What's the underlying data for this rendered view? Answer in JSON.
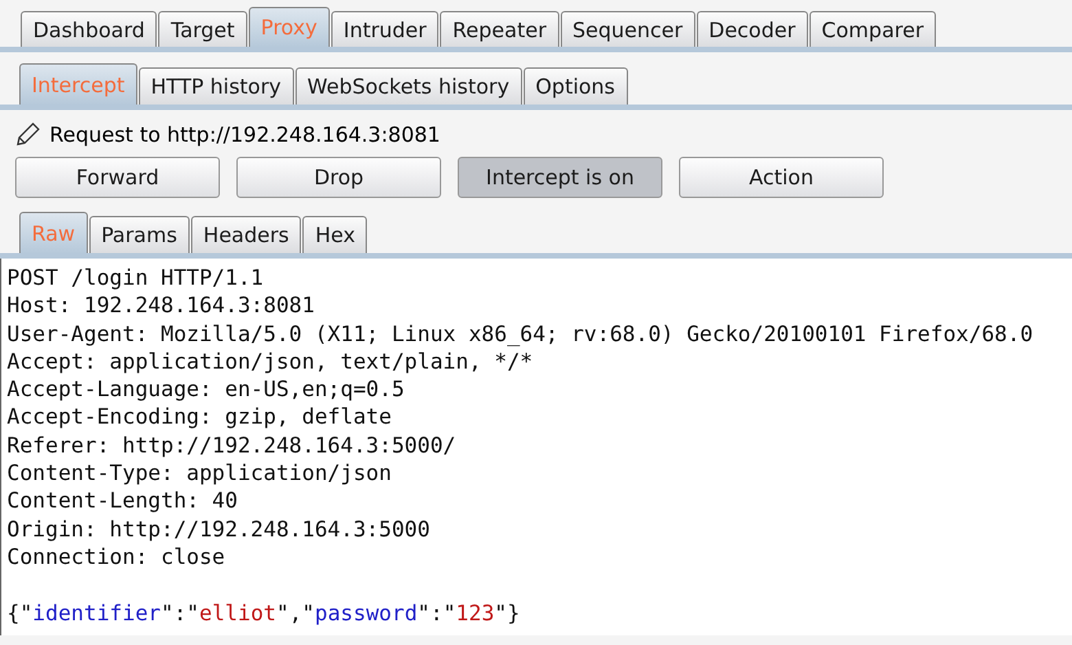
{
  "main_tabs": [
    {
      "label": "Dashboard",
      "selected": false
    },
    {
      "label": "Target",
      "selected": false
    },
    {
      "label": "Proxy",
      "selected": true
    },
    {
      "label": "Intruder",
      "selected": false
    },
    {
      "label": "Repeater",
      "selected": false
    },
    {
      "label": "Sequencer",
      "selected": false
    },
    {
      "label": "Decoder",
      "selected": false
    },
    {
      "label": "Comparer",
      "selected": false
    }
  ],
  "sub_tabs": [
    {
      "label": "Intercept",
      "selected": true
    },
    {
      "label": "HTTP history",
      "selected": false
    },
    {
      "label": "WebSockets history",
      "selected": false
    },
    {
      "label": "Options",
      "selected": false
    }
  ],
  "request_label": "Request to http://192.248.164.3:8081",
  "buttons": [
    {
      "label": "Forward",
      "pressed": false
    },
    {
      "label": "Drop",
      "pressed": false
    },
    {
      "label": "Intercept is on",
      "pressed": true
    },
    {
      "label": "Action",
      "pressed": false
    }
  ],
  "view_tabs": [
    {
      "label": "Raw",
      "selected": true
    },
    {
      "label": "Params",
      "selected": false
    },
    {
      "label": "Headers",
      "selected": false
    },
    {
      "label": "Hex",
      "selected": false
    }
  ],
  "request_lines": [
    "POST /login HTTP/1.1",
    "Host: 192.248.164.3:8081",
    "User-Agent: Mozilla/5.0 (X11; Linux x86_64; rv:68.0) Gecko/20100101 Firefox/68.0",
    "Accept: application/json, text/plain, */*",
    "Accept-Language: en-US,en;q=0.5",
    "Accept-Encoding: gzip, deflate",
    "Referer: http://192.248.164.3:5000/",
    "Content-Type: application/json",
    "Content-Length: 40",
    "Origin: http://192.248.164.3:5000",
    "Connection: close"
  ],
  "body_tokens": [
    {
      "kind": "punct",
      "text": "{\""
    },
    {
      "kind": "key",
      "text": "identifier"
    },
    {
      "kind": "punct",
      "text": "\":\""
    },
    {
      "kind": "value",
      "text": "elliot"
    },
    {
      "kind": "punct",
      "text": "\",\""
    },
    {
      "kind": "key",
      "text": "password"
    },
    {
      "kind": "punct",
      "text": "\":\""
    },
    {
      "kind": "value",
      "text": "123"
    },
    {
      "kind": "punct",
      "text": "\"}"
    }
  ]
}
